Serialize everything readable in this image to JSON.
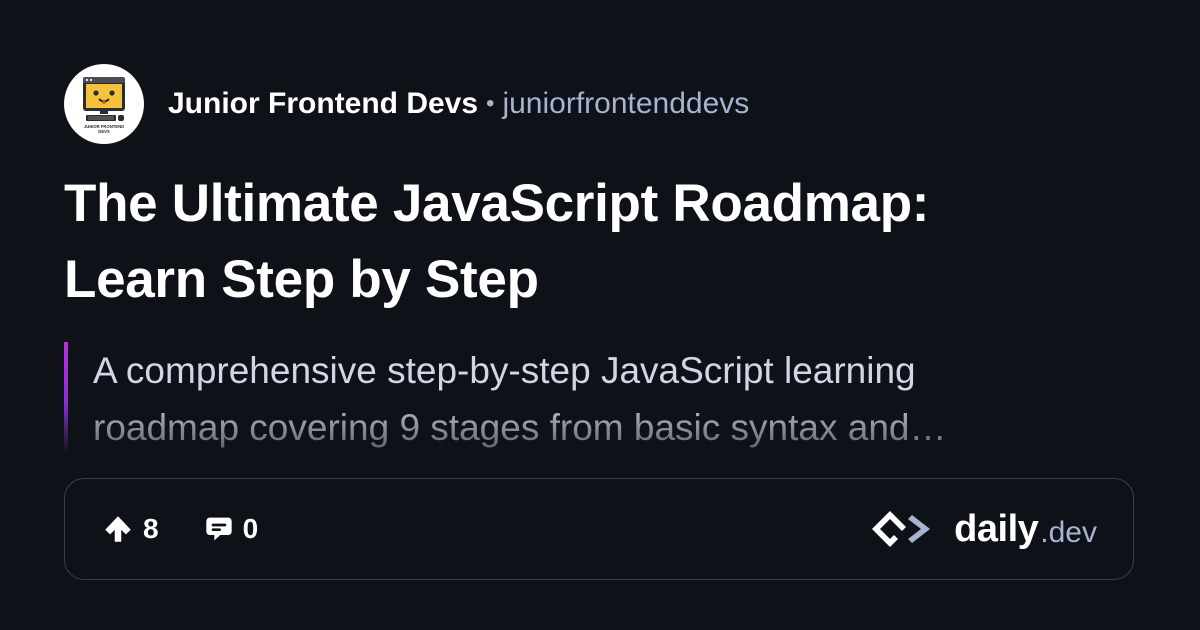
{
  "source": {
    "name": "Junior Frontend Devs",
    "separator": "•",
    "handle": "juniorfrontenddevs",
    "avatar_caption_line1": "JUNIOR FRONTEND",
    "avatar_caption_line2": "DEVS"
  },
  "post": {
    "title_line1": "The Ultimate JavaScript Roadmap:",
    "title_line2": "Learn Step by Step",
    "summary_line1": "A comprehensive step-by-step JavaScript learning",
    "summary_line2": "roadmap covering 9 stages from basic syntax and…"
  },
  "stats": {
    "upvotes": "8",
    "comments": "0"
  },
  "brand": {
    "name": "daily",
    "suffix": ".dev"
  },
  "colors": {
    "background": "#0e1117",
    "secondary_text": "#a8b3cf",
    "accent_bar": "#c02ee0",
    "avatar_face": "#f5c33b"
  }
}
